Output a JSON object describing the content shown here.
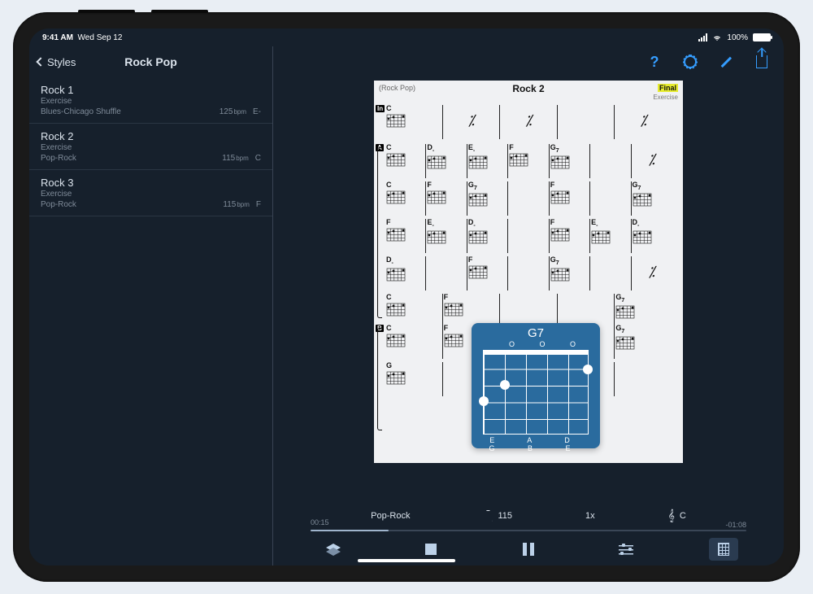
{
  "status": {
    "time": "9:41 AM",
    "date": "Wed Sep 12",
    "battery": "100%"
  },
  "sidebar": {
    "back_label": "Styles",
    "title": "Rock Pop",
    "items": [
      {
        "title": "Rock 1",
        "sub1": "Exercise",
        "sub2": "Blues-Chicago Shuffle",
        "bpm": "125",
        "bpm_u": "bpm",
        "key": "E-"
      },
      {
        "title": "Rock 2",
        "sub1": "Exercise",
        "sub2": "Pop-Rock",
        "bpm": "115",
        "bpm_u": "bpm",
        "key": "C"
      },
      {
        "title": "Rock 3",
        "sub1": "Exercise",
        "sub2": "Pop-Rock",
        "bpm": "115",
        "bpm_u": "bpm",
        "key": "F"
      }
    ]
  },
  "toolbar": {
    "help": "?",
    "settings": "gear",
    "edit": "pencil",
    "share": "share"
  },
  "score": {
    "style_label": "(Rock Pop)",
    "title": "Rock 2",
    "badge": "Final",
    "subtype": "Exercise",
    "sections": {
      "in": "In",
      "a": "A",
      "b": "B"
    },
    "lines": [
      [
        "C",
        "⁒",
        "⁒",
        "",
        "⁒"
      ],
      [
        "C",
        "D-",
        "E-",
        "F",
        "G7",
        "",
        "⁒"
      ],
      [
        "C",
        "F",
        "G7",
        "",
        "F",
        "",
        "G7"
      ],
      [
        "F",
        "E-",
        "D-",
        "",
        "F",
        "E-",
        "D-"
      ],
      [
        "D-",
        "",
        "F",
        "",
        "G7",
        "",
        "⁒"
      ],
      [
        "C",
        "F",
        "",
        "",
        "G7"
      ],
      [
        "C",
        "F",
        "",
        "",
        "G7"
      ],
      [
        "G"
      ]
    ],
    "big_chord": {
      "name": "G7",
      "open": "O  O  O",
      "strings": "E  A  D  G  B  E"
    }
  },
  "player": {
    "style": "Pop-Rock",
    "tempo": "115",
    "speed": "1x",
    "key": "C",
    "elapsed": "00:15",
    "remaining": "-01:08"
  }
}
